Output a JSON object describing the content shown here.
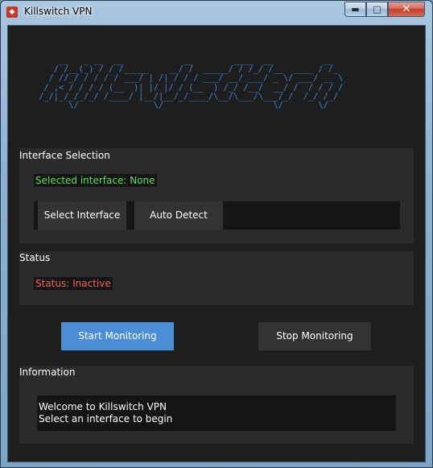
{
  "window": {
    "title": "Killswitch VPN",
    "icon": "shield-icon",
    "controls": {
      "minimize": "▬",
      "maximize": "□",
      "close": "✕"
    }
  },
  "banner": {
    "lines": [
      "     __   _ __  __            __        ____  __          __      ",
      "    / /__(_) / / /_____    __/ /  _____/ / /_/ /__  ____ / /_     ",
      "   / //_/ / / / / ___/ | /| / / / ___/ __/ ___/ _ \\/ ___/ __ \\  ",
      "  / ,< / / / / (__  )| |/ |/ / (__  ) /_/ /__/  __/ /  / / / /    ",
      " /_/|_/_/_/_/ /____/ |__/|__/_/____/\\__/\\___/\\___/_/  /_/ /_/  ",
      "       \\/               \\/                      \\/       \\/     "
    ]
  },
  "interface_section": {
    "title": "Interface Selection",
    "selected_text": "Selected interface: None",
    "select_button": "Select Interface",
    "auto_detect_button": "Auto Detect"
  },
  "status_section": {
    "title": "Status",
    "status_text": "Status: Inactive"
  },
  "actions": {
    "start": "Start Monitoring",
    "stop": "Stop Monitoring"
  },
  "info_section": {
    "title": "Information",
    "lines": [
      "Welcome to Killswitch VPN",
      "Select an interface to begin"
    ]
  },
  "colors": {
    "background": "#1e1e1e",
    "panel": "#2b2b2b",
    "accent": "#4a8ed6",
    "banner": "#3f86d6",
    "success": "#59e05a",
    "danger": "#f06565"
  }
}
